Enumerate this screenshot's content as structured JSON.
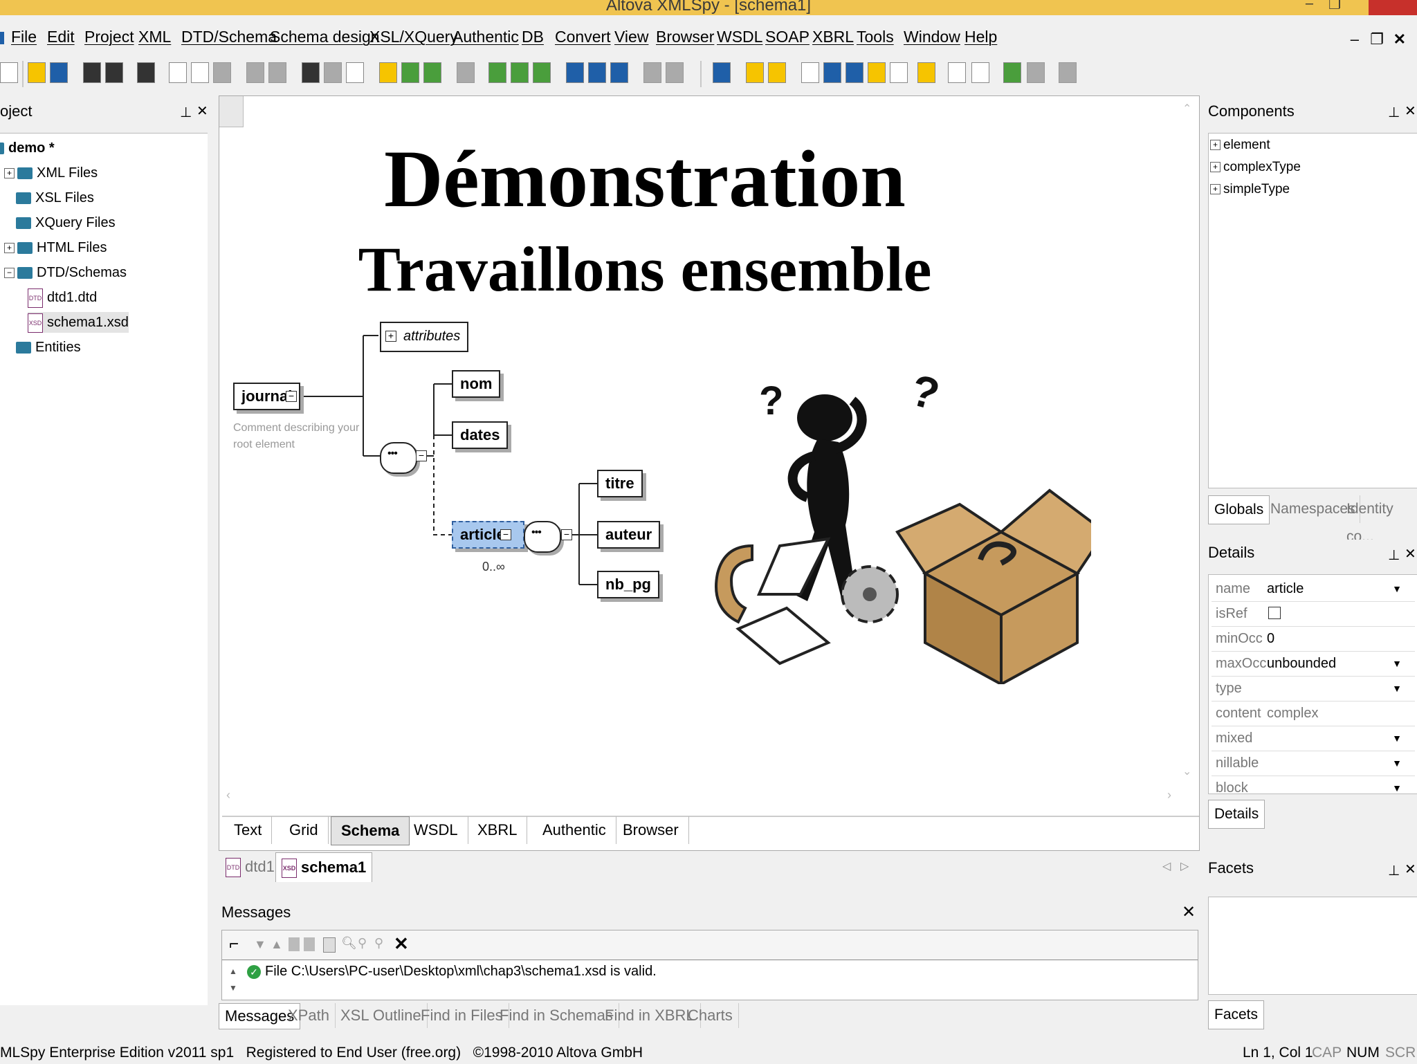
{
  "window": {
    "title": "Altova XMLSpy - [schema1]"
  },
  "menu": [
    "File",
    "Edit",
    "Project",
    "XML",
    "DTD/Schema",
    "Schema design",
    "XSL/XQuery",
    "Authentic",
    "DB",
    "Convert",
    "View",
    "Browser",
    "WSDL",
    "SOAP",
    "XBRL",
    "Tools",
    "Window",
    "Help"
  ],
  "project": {
    "title": "oject",
    "items": [
      "demo *",
      "XML Files",
      "XSL Files",
      "XQuery Files",
      "HTML Files",
      "DTD/Schemas",
      "dtd1.dtd",
      "schema1.xsd",
      "Entities"
    ]
  },
  "slide": {
    "title": "Démonstration",
    "subtitle": "Travaillons ensemble"
  },
  "schema": {
    "root": "journal",
    "root_comment": "Comment describing your root element",
    "attributes": "attributes",
    "children": [
      "nom",
      "dates"
    ],
    "selected": "article",
    "occurrence": "0..∞",
    "article_children": [
      "titre",
      "auteur",
      "nb_pg"
    ]
  },
  "view_tabs": [
    "Text",
    "Grid",
    "Schema",
    "WSDL",
    "XBRL",
    "Authentic",
    "Browser"
  ],
  "doc_tabs": [
    "dtd1",
    "schema1"
  ],
  "components": {
    "title": "Components",
    "items": [
      "element",
      "complexType",
      "simpleType"
    ],
    "tabs": [
      "Globals",
      "Namespaces",
      "Identity co..."
    ]
  },
  "details": {
    "title": "Details",
    "tab": "Details",
    "rows": [
      {
        "key": "name",
        "value": "article"
      },
      {
        "key": "isRef",
        "value": ""
      },
      {
        "key": "minOcc",
        "value": "0"
      },
      {
        "key": "maxOcc",
        "value": "unbounded"
      },
      {
        "key": "type",
        "value": ""
      },
      {
        "key": "content",
        "value": "complex"
      },
      {
        "key": "mixed",
        "value": ""
      },
      {
        "key": "nillable",
        "value": ""
      },
      {
        "key": "block",
        "value": ""
      }
    ]
  },
  "facets": {
    "title": "Facets",
    "tab": "Facets"
  },
  "messages": {
    "title": "Messages",
    "text": "File C:\\Users\\PC-user\\Desktop\\xml\\chap3\\schema1.xsd is valid.",
    "tabs": [
      "Messages",
      "XPath",
      "XSL Outline",
      "Find in Files",
      "Find in Schemas",
      "Find in XBRL",
      "Charts"
    ]
  },
  "status": {
    "left": "MLSpy Enterprise Edition v2011 sp1   Registered to End User (free.org)   ©1998-2010 Altova GmbH",
    "position": "Ln 1, Col 1",
    "cap": "CAP",
    "num": "NUM",
    "scrl": "SCRL"
  }
}
